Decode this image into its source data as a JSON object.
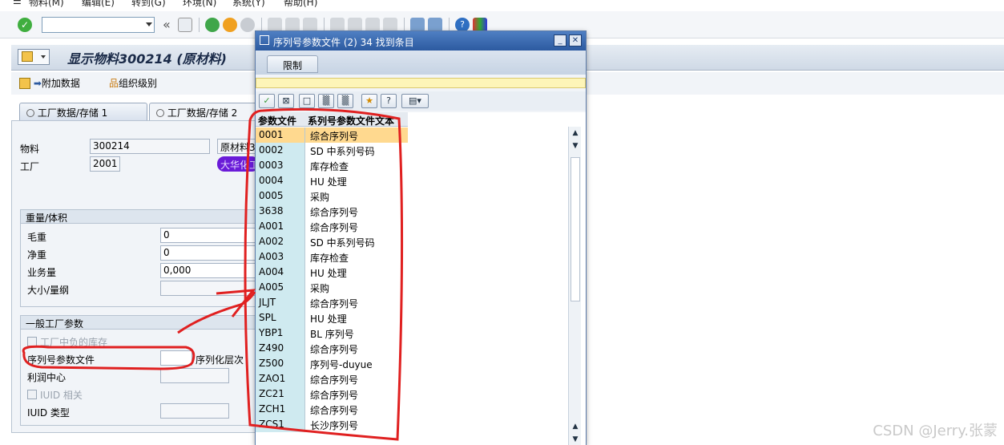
{
  "menu": [
    "物料(M)",
    "编辑(E)",
    "转到(G)",
    "环境(N)",
    "系统(Y)",
    "帮助(H)"
  ],
  "toolbar": {
    "nav_back": "«"
  },
  "page_title": "显示物料300214 (原材料)",
  "app_toolbar": {
    "additional_data": "附加数据",
    "org_levels": "组织级别"
  },
  "tabs": [
    "工厂数据/存储 1",
    "工厂数据/存储 2"
  ],
  "header_fields": {
    "material_label": "物料",
    "material_value": "300214",
    "material_desc": "原材料3",
    "plant_label": "工厂",
    "plant_value": "2001",
    "plant_desc": "大华化工"
  },
  "weight_group": {
    "title": "重量/体积",
    "rows": [
      {
        "label": "毛重",
        "value": "0"
      },
      {
        "label": "净重",
        "value": "0"
      },
      {
        "label": "业务量",
        "value": "0,000"
      },
      {
        "label": "大小/量纲",
        "value": ""
      }
    ]
  },
  "plant_params": {
    "title": "一般工厂参数",
    "neg_stock": "工厂中负的库存",
    "serial_profile": "序列号参数文件",
    "serial_level": "序列化层次",
    "profit_center": "利润中心",
    "iuid_relevant": "IUID 相关",
    "iuid_type": "IUID 类型"
  },
  "dialog": {
    "title": "序列号参数文件 (2)   34 找到条目",
    "restrict_tab": "限制",
    "col_profile": "参数文件",
    "col_text": "系列号参数文件文本",
    "rows": [
      {
        "code": "0001",
        "text": "综合序列号",
        "selected": true
      },
      {
        "code": "0002",
        "text": "SD 中系列号码"
      },
      {
        "code": "0003",
        "text": "库存检查"
      },
      {
        "code": "0004",
        "text": "HU 处理"
      },
      {
        "code": "0005",
        "text": "采购"
      },
      {
        "code": "3638",
        "text": "综合序列号"
      },
      {
        "code": "A001",
        "text": "综合序列号"
      },
      {
        "code": "A002",
        "text": "SD 中系列号码"
      },
      {
        "code": "A003",
        "text": "库存检查"
      },
      {
        "code": "A004",
        "text": "HU 处理"
      },
      {
        "code": "A005",
        "text": "采购"
      },
      {
        "code": "JLJT",
        "text": "综合序列号"
      },
      {
        "code": "SPL",
        "text": "HU 处理"
      },
      {
        "code": "YBP1",
        "text": "BL 序列号"
      },
      {
        "code": "Z490",
        "text": "综合序列号"
      },
      {
        "code": "Z500",
        "text": "序列号-duyue"
      },
      {
        "code": "ZAO1",
        "text": "综合序列号"
      },
      {
        "code": "ZC21",
        "text": "综合序列号"
      },
      {
        "code": "ZCH1",
        "text": "综合序列号"
      },
      {
        "code": "ZCS1",
        "text": "长沙序列号"
      }
    ]
  },
  "colors": {
    "annotation_red": "#e02020",
    "highlight_purple": "#6a1bd8"
  },
  "watermark": "CSDN @Jerry.张蒙"
}
